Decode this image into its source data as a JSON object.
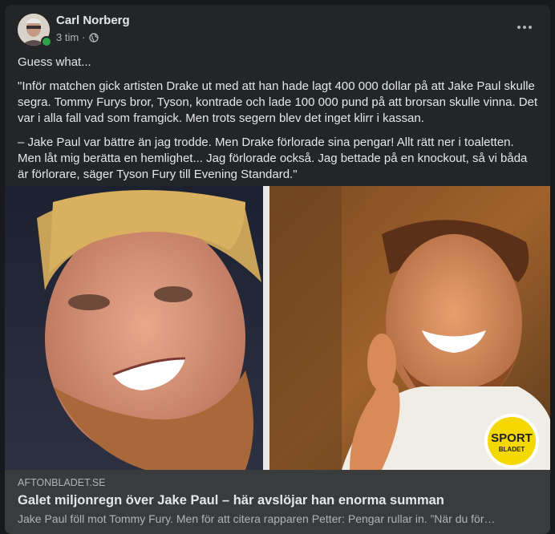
{
  "post": {
    "author": "Carl Norberg",
    "time": "3 tim",
    "separator": "·",
    "audience_icon": "globe-icon",
    "more_icon": "more-horizontal-icon",
    "paragraphs": [
      "Guess what...",
      "\"Inför matchen gick artisten Drake ut med att han hade lagt 400 000 dollar på att Jake Paul skulle segra. Tommy Furys bror, Tyson, kontrade och lade 100 000 pund på att brorsan skulle vinna. Det var i alla fall vad som framgick. Men trots segern blev det inget klirr i kassan.",
      "– Jake Paul var bättre än jag trodde. Men Drake förlorade sina pengar! Allt rätt ner i toaletten. Men låt mig berätta en hemlighet... Jag förlorade också. Jag bettade på en knockout, så vi båda är förlorare, säger Tyson Fury till Evening Standard.\""
    ]
  },
  "media": {
    "logo_line1": "SPORT",
    "logo_line2": "BLADET"
  },
  "link_preview": {
    "domain": "AFTONBLADET.SE",
    "title": "Galet miljonregn över Jake Paul – här avslöjar han enorma summan",
    "description": "Jake Paul föll mot Tommy Fury. Men för att citera rapparen Petter: Pengar rullar in. ”När du för…"
  },
  "colors": {
    "card_bg": "#242526",
    "page_bg": "#18191a",
    "preview_bg": "#3a3b3c",
    "online": "#31a24c",
    "logo_yellow": "#f5d800"
  }
}
